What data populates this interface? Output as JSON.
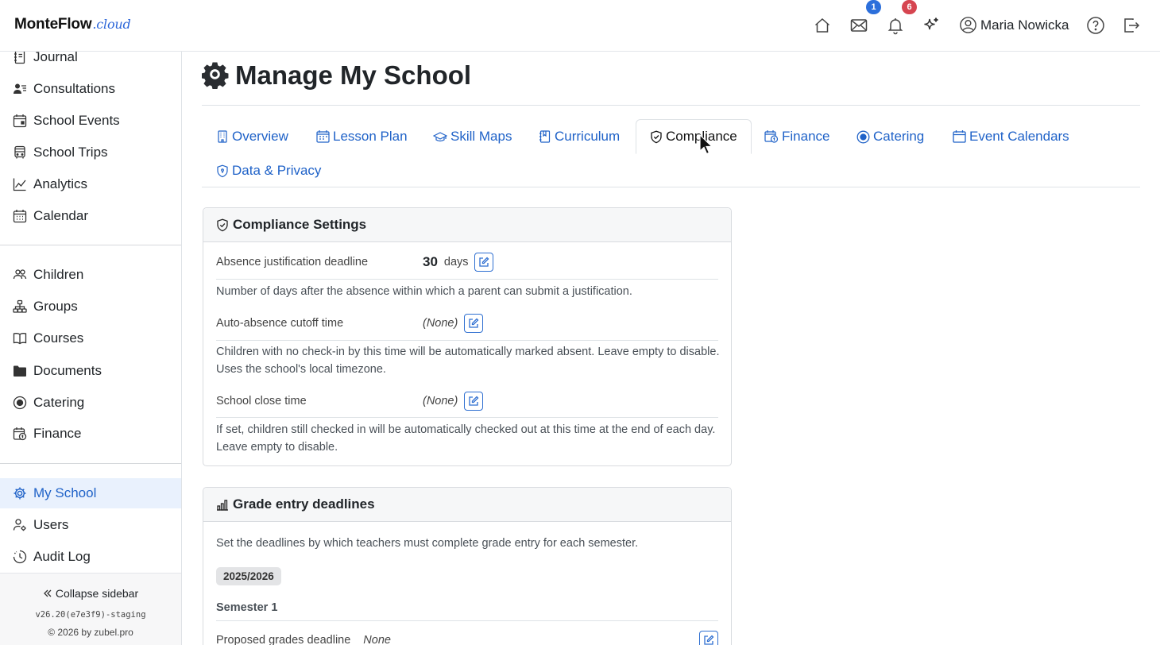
{
  "brand": {
    "name": "MonteFlow",
    "tld": ".cloud"
  },
  "topbar": {
    "mail_count": "1",
    "notif_count": "6",
    "user_name": "Maria Nowicka",
    "colors": {
      "mail_badge": "#2c6fdb",
      "notif_badge": "#d64550"
    }
  },
  "sidebar": {
    "group1": [
      {
        "label": "Journal",
        "icon": "journal-icon"
      },
      {
        "label": "Consultations",
        "icon": "consultations-icon"
      },
      {
        "label": "School Events",
        "icon": "calendar-event-icon"
      },
      {
        "label": "School Trips",
        "icon": "bus-icon"
      },
      {
        "label": "Analytics",
        "icon": "chart-line-icon"
      },
      {
        "label": "Calendar",
        "icon": "calendar-grid-icon"
      }
    ],
    "group2": [
      {
        "label": "Children",
        "icon": "people-icon"
      },
      {
        "label": "Groups",
        "icon": "diagram-icon"
      },
      {
        "label": "Courses",
        "icon": "book-icon"
      },
      {
        "label": "Documents",
        "icon": "folder-icon"
      },
      {
        "label": "Catering",
        "icon": "record-circle-icon"
      },
      {
        "label": "Finance",
        "icon": "cash-calendar-icon"
      }
    ],
    "group3": [
      {
        "label": "My School",
        "icon": "gear-icon",
        "active": true
      },
      {
        "label": "Users",
        "icon": "person-gear-icon"
      },
      {
        "label": "Audit Log",
        "icon": "clock-history-icon"
      }
    ],
    "collapse_label": "Collapse sidebar",
    "version": "v26.20(e7e3f9)-staging",
    "copyright": "© 2026 by zubel.pro"
  },
  "page": {
    "title": "Manage My School"
  },
  "tabs": [
    {
      "label": "Overview",
      "icon": "building-icon"
    },
    {
      "label": "Lesson Plan",
      "icon": "calendar-week-icon"
    },
    {
      "label": "Skill Maps",
      "icon": "mortarboard-icon"
    },
    {
      "label": "Curriculum",
      "icon": "journal-bookmark-icon"
    },
    {
      "label": "Compliance",
      "icon": "shield-check-icon",
      "active": true
    },
    {
      "label": "Finance",
      "icon": "cash-calendar-icon"
    },
    {
      "label": "Catering",
      "icon": "record-circle-icon"
    },
    {
      "label": "Event Calendars",
      "icon": "calendar-icon"
    },
    {
      "label": "Data & Privacy",
      "icon": "shield-lock-icon"
    }
  ],
  "compliance": {
    "title": "Compliance Settings",
    "rows": [
      {
        "label": "Absence justification deadline",
        "value": "30",
        "unit": "days",
        "desc": "Number of days after the absence within which a parent can submit a justification."
      },
      {
        "label": "Auto-absence cutoff time",
        "value": "(None)",
        "desc": "Children with no check-in by this time will be automatically marked absent. Leave empty to disable. Uses the school's local timezone."
      },
      {
        "label": "School close time",
        "value": "(None)",
        "desc": "If set, children still checked in will be automatically checked out at this time at the end of each day. Leave empty to disable."
      }
    ]
  },
  "grades": {
    "title": "Grade entry deadlines",
    "desc": "Set the deadlines by which teachers must complete grade entry for each semester.",
    "year": "2025/2026",
    "semester": "Semester 1",
    "row_label": "Proposed grades deadline",
    "row_value": "None"
  },
  "theme": {
    "link": "#1f62c8",
    "active_bg": "#e9f1fd"
  }
}
